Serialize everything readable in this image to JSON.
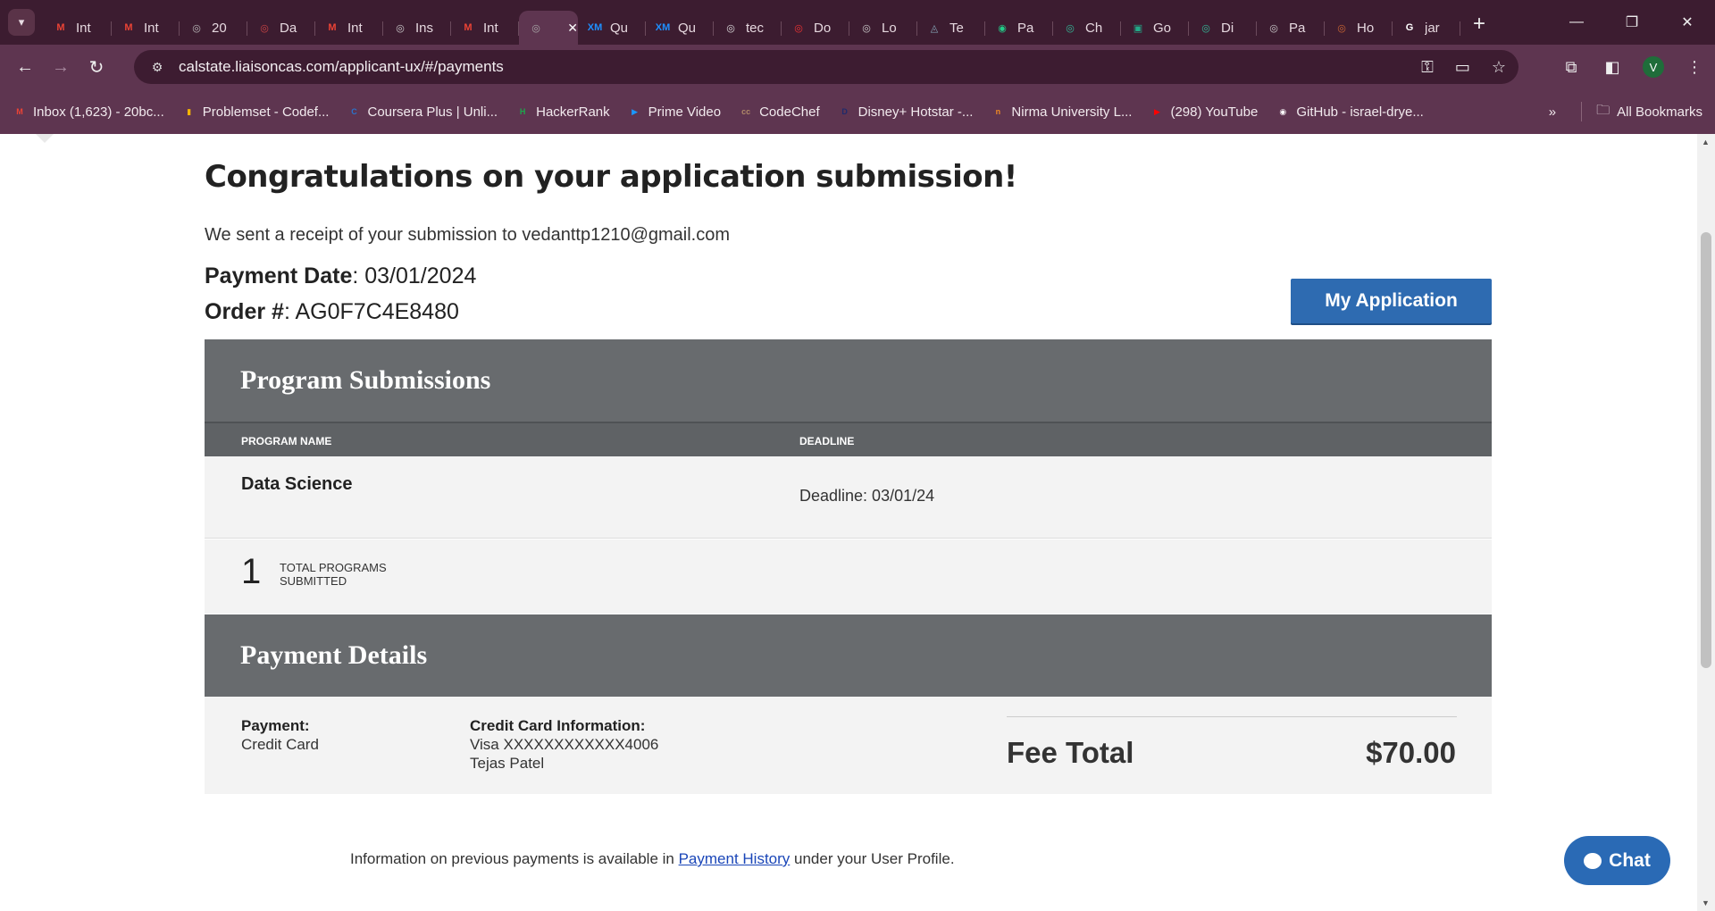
{
  "browser": {
    "tabs": [
      {
        "icon": "gmail-icon",
        "label": "Int",
        "fav": "M",
        "color": "#ea4335"
      },
      {
        "icon": "gmail-icon",
        "label": "Int",
        "fav": "M",
        "color": "#ea4335"
      },
      {
        "icon": "globe-icon",
        "label": "20",
        "fav": "◎",
        "color": "#bbb"
      },
      {
        "icon": "web-icon",
        "label": "Da",
        "fav": "◎",
        "color": "#c44"
      },
      {
        "icon": "gmail-icon",
        "label": "Int",
        "fav": "M",
        "color": "#ea4335"
      },
      {
        "icon": "web-icon",
        "label": "Ins",
        "fav": "◎",
        "color": "#ccc"
      },
      {
        "icon": "gmail-icon",
        "label": "Int",
        "fav": "M",
        "color": "#ea4335"
      },
      {
        "icon": "globe-icon",
        "label": "",
        "fav": "◎",
        "color": "#aaa",
        "active": true
      },
      {
        "icon": "xm-icon",
        "label": "Qu",
        "fav": "XM",
        "color": "#1e90ff"
      },
      {
        "icon": "xm-icon",
        "label": "Qu",
        "fav": "XM",
        "color": "#1e90ff"
      },
      {
        "icon": "web-icon",
        "label": "tec",
        "fav": "◎",
        "color": "#ddd"
      },
      {
        "icon": "web-icon",
        "label": "Do",
        "fav": "◎",
        "color": "#e33"
      },
      {
        "icon": "web-icon",
        "label": "Lo",
        "fav": "◎",
        "color": "#ccc"
      },
      {
        "icon": "web-icon",
        "label": "Te",
        "fav": "◬",
        "color": "#8ab"
      },
      {
        "icon": "web-icon",
        "label": "Pa",
        "fav": "◉",
        "color": "#2c8"
      },
      {
        "icon": "chatgpt-icon",
        "label": "Ch",
        "fav": "◎",
        "color": "#3b9"
      },
      {
        "icon": "meet-icon",
        "label": "Go",
        "fav": "▣",
        "color": "#2a8"
      },
      {
        "icon": "chatgpt-icon",
        "label": "Di",
        "fav": "◎",
        "color": "#3b9"
      },
      {
        "icon": "web-icon",
        "label": "Pa",
        "fav": "◎",
        "color": "#ccc"
      },
      {
        "icon": "web-icon",
        "label": "Ho",
        "fav": "◎",
        "color": "#c63"
      },
      {
        "icon": "google-icon",
        "label": "jar",
        "fav": "G",
        "color": "#fff"
      }
    ],
    "url": "calstate.liaisoncas.com/applicant-ux/#/payments",
    "profile_initial": "V",
    "bookmarks": [
      {
        "label": "Inbox (1,623) - 20bc...",
        "fav": "M",
        "color": "#ea4335"
      },
      {
        "label": "Problemset - Codef...",
        "fav": "▮",
        "color": "#f4b400"
      },
      {
        "label": "Coursera Plus | Unli...",
        "fav": "C",
        "color": "#2a73cc"
      },
      {
        "label": "HackerRank",
        "fav": "H",
        "color": "#1ba94c"
      },
      {
        "label": "Prime Video",
        "fav": "▶",
        "color": "#1a98ff"
      },
      {
        "label": "CodeChef",
        "fav": "cc",
        "color": "#b08968"
      },
      {
        "label": "Disney+ Hotstar -...",
        "fav": "D",
        "color": "#1f2a6b"
      },
      {
        "label": "Nirma University L...",
        "fav": "n",
        "color": "#f08a24"
      },
      {
        "label": "(298) YouTube",
        "fav": "▶",
        "color": "#ff0000"
      },
      {
        "label": "GitHub - israel-drye...",
        "fav": "◉",
        "color": "#fff"
      }
    ],
    "all_bookmarks": "All Bookmarks"
  },
  "page": {
    "title": "Congratulations on your application submission!",
    "receipt_text": "We sent a receipt of your submission to vedanttp1210@gmail.com",
    "payment_date_label": "Payment Date",
    "payment_date_value": ": 03/01/2024",
    "order_label": "Order #",
    "order_value": ": AG0F7C4E8480",
    "my_application_button": "My Application",
    "program_submissions": {
      "heading": "Program Submissions",
      "col_program": "PROGRAM NAME",
      "col_deadline": "DEADLINE",
      "rows": [
        {
          "program": "Data Science",
          "deadline": "Deadline: 03/01/24"
        }
      ],
      "total_count": "1",
      "total_label": "TOTAL PROGRAMS SUBMITTED"
    },
    "payment_details": {
      "heading": "Payment Details",
      "payment_label": "Payment:",
      "payment_value": "Credit Card",
      "cc_label": "Credit Card Information:",
      "cc_number": "Visa XXXXXXXXXXXX4006",
      "cc_name": "Tejas Patel",
      "fee_label": "Fee Total",
      "fee_value": "$70.00"
    },
    "footer_prefix": "Information on previous payments is available in ",
    "footer_link": "Payment History",
    "footer_suffix": " under your User Profile.",
    "chat_label": "Chat"
  },
  "colors": {
    "tabbar": "#3c1c30",
    "toolbar": "#5e3550",
    "section_header": "#686b6e",
    "primary_button": "#2e6bb1"
  }
}
